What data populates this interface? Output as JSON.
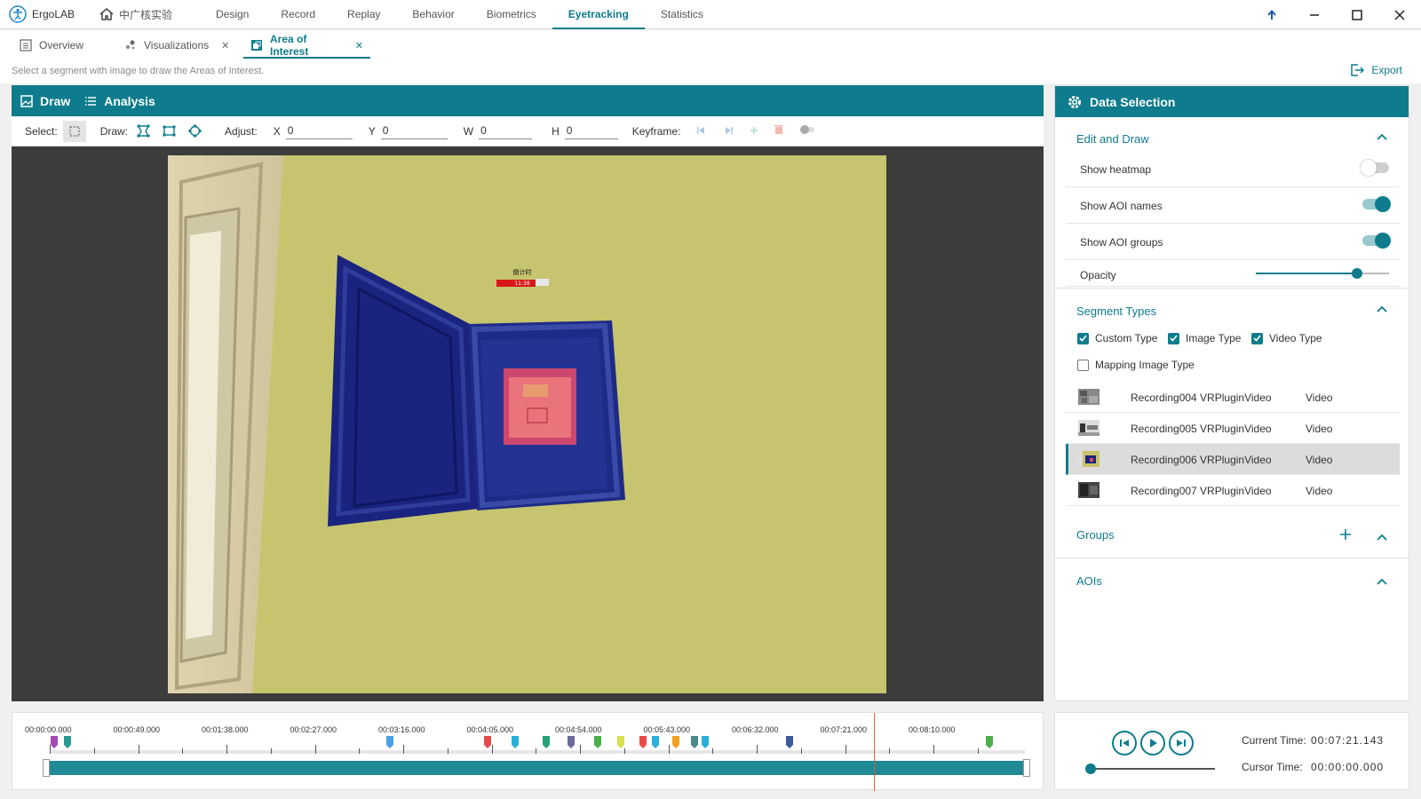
{
  "app": {
    "name": "ErgoLAB",
    "home_label": "中广核实验"
  },
  "nav": [
    "Design",
    "Record",
    "Replay",
    "Behavior",
    "Biometrics",
    "Eyetracking",
    "Statistics"
  ],
  "nav_active": "Eyetracking",
  "tabs": [
    {
      "label": "Overview",
      "icon": "overview-icon",
      "closable": false
    },
    {
      "label": "Visualizations",
      "icon": "visualizations-icon",
      "closable": true
    },
    {
      "label": "Area of Interest",
      "icon": "aoi-icon",
      "closable": true,
      "active": true
    }
  ],
  "hint": "Select a segment with image to draw the Areas of Interest.",
  "export_label": "Export",
  "left_header": {
    "draw": "Draw",
    "analysis": "Analysis"
  },
  "toolbar": {
    "select_label": "Select:",
    "draw_label": "Draw:",
    "adjust_label": "Adjust:",
    "x_label": "X",
    "x_value": "0",
    "y_label": "Y",
    "y_value": "0",
    "w_label": "W",
    "w_value": "0",
    "h_label": "H",
    "h_value": "0",
    "keyframe_label": "Keyframe:"
  },
  "scene": {
    "sign_text": "倒计时",
    "sign_time": "11:38"
  },
  "data_selection": {
    "title": "Data Selection",
    "edit_draw": {
      "title": "Edit and Draw",
      "show_heatmap": {
        "label": "Show heatmap",
        "on": false
      },
      "show_aoi_names": {
        "label": "Show AOI names",
        "on": true
      },
      "show_aoi_groups": {
        "label": "Show AOI groups",
        "on": true
      },
      "opacity": {
        "label": "Opacity",
        "value": 0.76
      }
    },
    "segment_types": {
      "title": "Segment Types",
      "options": [
        {
          "label": "Custom Type",
          "checked": true
        },
        {
          "label": "Image Type",
          "checked": true
        },
        {
          "label": "Video Type",
          "checked": true
        },
        {
          "label": "Mapping Image Type",
          "checked": false
        }
      ],
      "recordings": [
        {
          "name": "Recording004 VRPluginVideo",
          "type": "Video",
          "selected": false
        },
        {
          "name": "Recording005 VRPluginVideo",
          "type": "Video",
          "selected": false
        },
        {
          "name": "Recording006 VRPluginVideo",
          "type": "Video",
          "selected": true
        },
        {
          "name": "Recording007 VRPluginVideo",
          "type": "Video",
          "selected": false
        }
      ]
    },
    "groups_title": "Groups",
    "aois_title": "AOIs"
  },
  "timeline": {
    "labels": [
      "00:00:00.000",
      "00:00:49.000",
      "00:01:38.000",
      "00:02:27.000",
      "00:03:16.000",
      "00:04:05.000",
      "00:04:54.000",
      "00:05:43.000",
      "00:06:32.000",
      "00:07:21.000",
      "00:08:10.000"
    ],
    "marker_colors": [
      "#a64ab8",
      "#2a9a8f",
      "#4aa0e8",
      "#e84a4a",
      "#2ab0d8",
      "#2aa07a",
      "#6a6aa0",
      "#4ab04a",
      "#d8e04a",
      "#e84a4a",
      "#2ab0d8",
      "#f0a020",
      "#4a8a8a",
      "#2ab0d8",
      "#3a5aa0",
      "#4ab04a"
    ],
    "cursor_time": "00:07:21.000"
  },
  "player": {
    "current_label": "Current Time:",
    "current_value": "00:07:21.143",
    "cursor_label": "Cursor Time:",
    "cursor_value": "00:00:00.000"
  },
  "colors": {
    "accent": "#0e7c8c",
    "cursor": "#f05a3a"
  }
}
